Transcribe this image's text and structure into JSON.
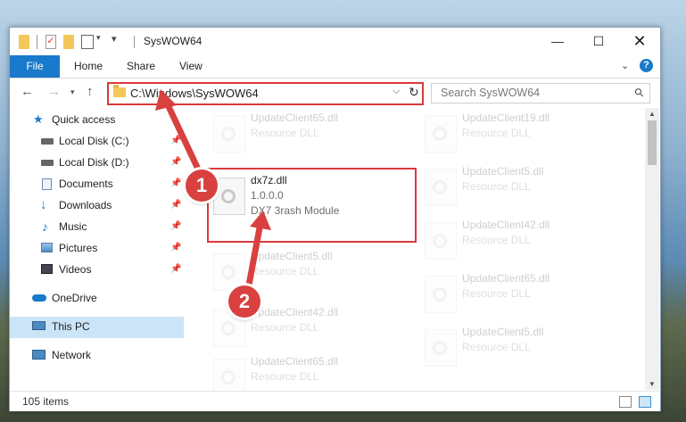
{
  "window": {
    "title": "SysWOW64"
  },
  "ribbon": {
    "tabs": [
      "File",
      "Home",
      "Share",
      "View"
    ],
    "help_label": "?"
  },
  "nav": {
    "address": "C:\\Windows\\SysWOW64",
    "search_placeholder": "Search SysWOW64"
  },
  "sidebar": {
    "items": [
      {
        "label": "Quick access",
        "icon": "star-icon",
        "pinned": false
      },
      {
        "label": "Local Disk (C:)",
        "icon": "drive-icon",
        "pinned": true
      },
      {
        "label": "Local Disk (D:)",
        "icon": "drive-icon",
        "pinned": true
      },
      {
        "label": "Documents",
        "icon": "documents-icon",
        "pinned": true
      },
      {
        "label": "Downloads",
        "icon": "download-icon",
        "pinned": true
      },
      {
        "label": "Music",
        "icon": "music-icon",
        "pinned": true
      },
      {
        "label": "Pictures",
        "icon": "pictures-icon",
        "pinned": true
      },
      {
        "label": "Videos",
        "icon": "videos-icon",
        "pinned": true
      },
      {
        "label": "OneDrive",
        "icon": "cloud-icon",
        "pinned": false
      },
      {
        "label": "This PC",
        "icon": "computer-icon",
        "pinned": false,
        "selected": true
      },
      {
        "label": "Network",
        "icon": "network-icon",
        "pinned": false
      }
    ]
  },
  "files": {
    "col1": [
      {
        "name": "UpdateClient65.dll",
        "desc": "Resource DLL"
      },
      {
        "name": "dx7z.dll",
        "version": "1.0.0.0",
        "desc": "DX7 3rash Module",
        "highlighted": true
      },
      {
        "name": "UpdateClient5.dll",
        "desc": "Resource DLL"
      },
      {
        "name": "UpdateClient42.dll",
        "desc": "Resource DLL"
      },
      {
        "name": "UpdateClient65.dll",
        "desc": "Resource DLL"
      }
    ],
    "col2": [
      {
        "name": "UpdateClient19.dll",
        "desc": "Resource DLL"
      },
      {
        "name": "UpdateClient5.dll",
        "desc": "Resource DLL"
      },
      {
        "name": "UpdateClient42.dll",
        "desc": "Resource DLL"
      },
      {
        "name": "UpdateClient65.dll",
        "desc": "Resource DLL"
      },
      {
        "name": "UpdateClient5.dll",
        "desc": "Resource DLL"
      }
    ]
  },
  "status": {
    "item_count": "105 items"
  },
  "annotations": {
    "badge1": "1",
    "badge2": "2",
    "color": "#d93a3a"
  }
}
